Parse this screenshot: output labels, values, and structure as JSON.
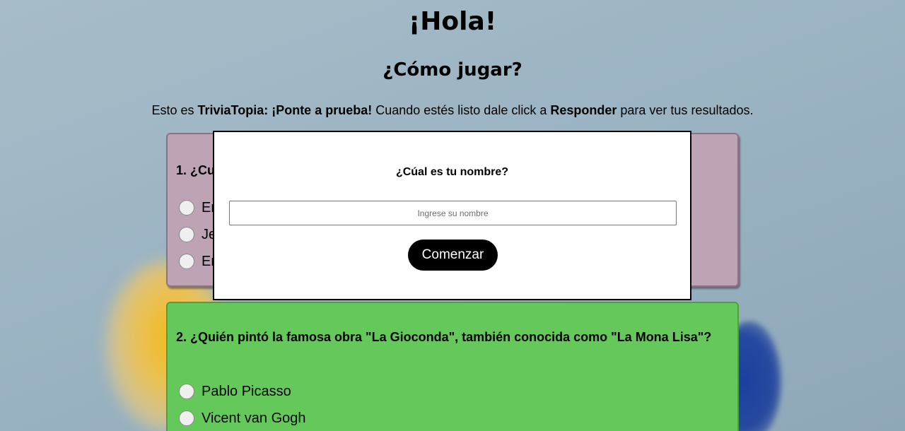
{
  "header": {
    "title": "¡Hola!",
    "subtitle": "¿Cómo jugar?",
    "intro": {
      "part1": "Esto es ",
      "brand": "TriviaTopia: ¡Ponte a prueba!",
      "part2": " Cuando estés listo dale click a ",
      "action": "Responder",
      "part3": " para ver tus resultados."
    }
  },
  "questions": [
    {
      "title": "1. ¿Cu",
      "options": [
        "Er",
        "Je",
        "Er"
      ],
      "color": "#bda3b3"
    },
    {
      "title": "2. ¿Quién pintó la famosa obra \"La Gioconda\", también conocida como \"La Mona Lisa\"?",
      "options": [
        "Pablo Picasso",
        "Vicent van Gogh"
      ],
      "color": "#64c85a"
    }
  ],
  "modal": {
    "title": "¿Cúal es tu nombre?",
    "input_placeholder": "Ingrese su nombre",
    "input_value": "",
    "button_label": "Comenzar"
  }
}
